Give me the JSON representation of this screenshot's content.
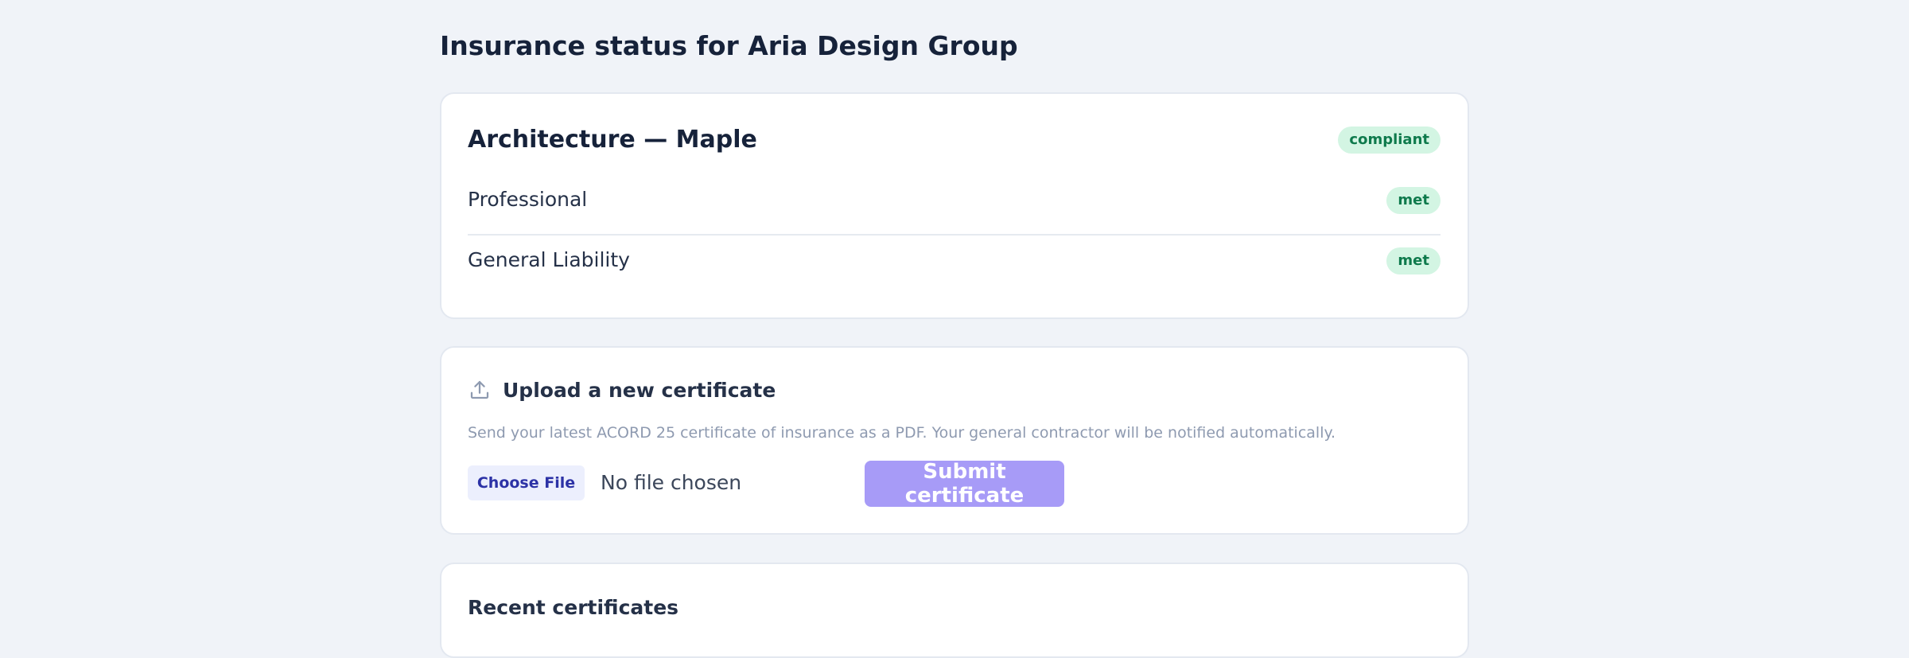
{
  "header": {
    "title": "Insurance status for Aria Design Group"
  },
  "project": {
    "title": "Architecture — Maple",
    "status": "compliant",
    "requirements": [
      {
        "label": "Professional",
        "status": "met"
      },
      {
        "label": "General Liability",
        "status": "met"
      }
    ]
  },
  "upload": {
    "icon": "upload-icon",
    "title": "Upload a new certificate",
    "description": "Send your latest ACORD 25 certificate of insurance as a PDF. Your general contractor will be notified automatically.",
    "choose_file_label": "Choose File",
    "file_status": "No file chosen",
    "submit_label": "Submit certificate"
  },
  "recent": {
    "title": "Recent certificates"
  },
  "colors": {
    "background": "#f0f3f8",
    "badge_bg": "#d3f5e3",
    "badge_text": "#0e7a4c",
    "submit_bg": "#a79bf7",
    "choose_bg": "#eceffd"
  }
}
